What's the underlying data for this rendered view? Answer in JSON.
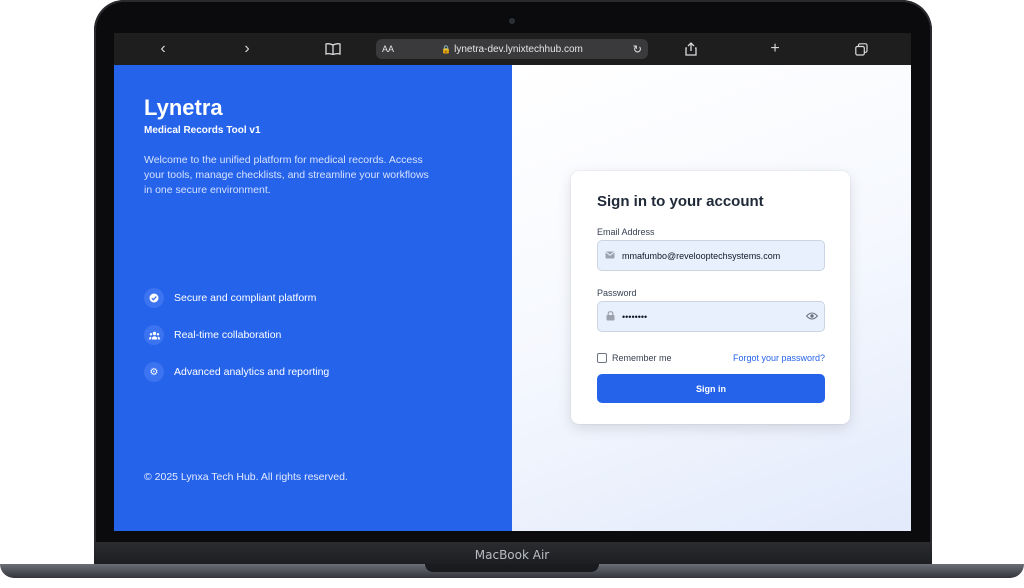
{
  "device": {
    "label": "MacBook Air"
  },
  "browser": {
    "aa_label": "AA",
    "url": "lynetra-dev.lynixtechhub.com",
    "icons": [
      "back-icon",
      "forward-icon",
      "bookmarks-icon",
      "lock-icon",
      "reload-icon",
      "share-icon",
      "new-tab-icon",
      "tabs-icon"
    ]
  },
  "left": {
    "brand": "Lynetra",
    "subtitle": "Medical Records Tool v1",
    "welcome": "Welcome to the unified platform for medical records. Access your tools, manage checklists, and streamline your workflows in one secure environment.",
    "features": [
      {
        "icon": "shield-check-icon",
        "label": "Secure and compliant platform"
      },
      {
        "icon": "users-icon",
        "label": "Real-time collaboration"
      },
      {
        "icon": "gear-icon",
        "label": "Advanced analytics and reporting"
      }
    ],
    "copyright": "© 2025 Lynxa Tech Hub. All rights reserved."
  },
  "form": {
    "title": "Sign in to your account",
    "email_label": "Email Address",
    "email_value": "mmafumbo@revelooptechsystems.com",
    "password_label": "Password",
    "password_value": "••••••••",
    "remember_label": "Remember me",
    "forgot_label": "Forgot your password?",
    "submit_label": "Sign in"
  },
  "colors": {
    "primary": "#2563eb",
    "field_bg": "#e8f0fe"
  }
}
